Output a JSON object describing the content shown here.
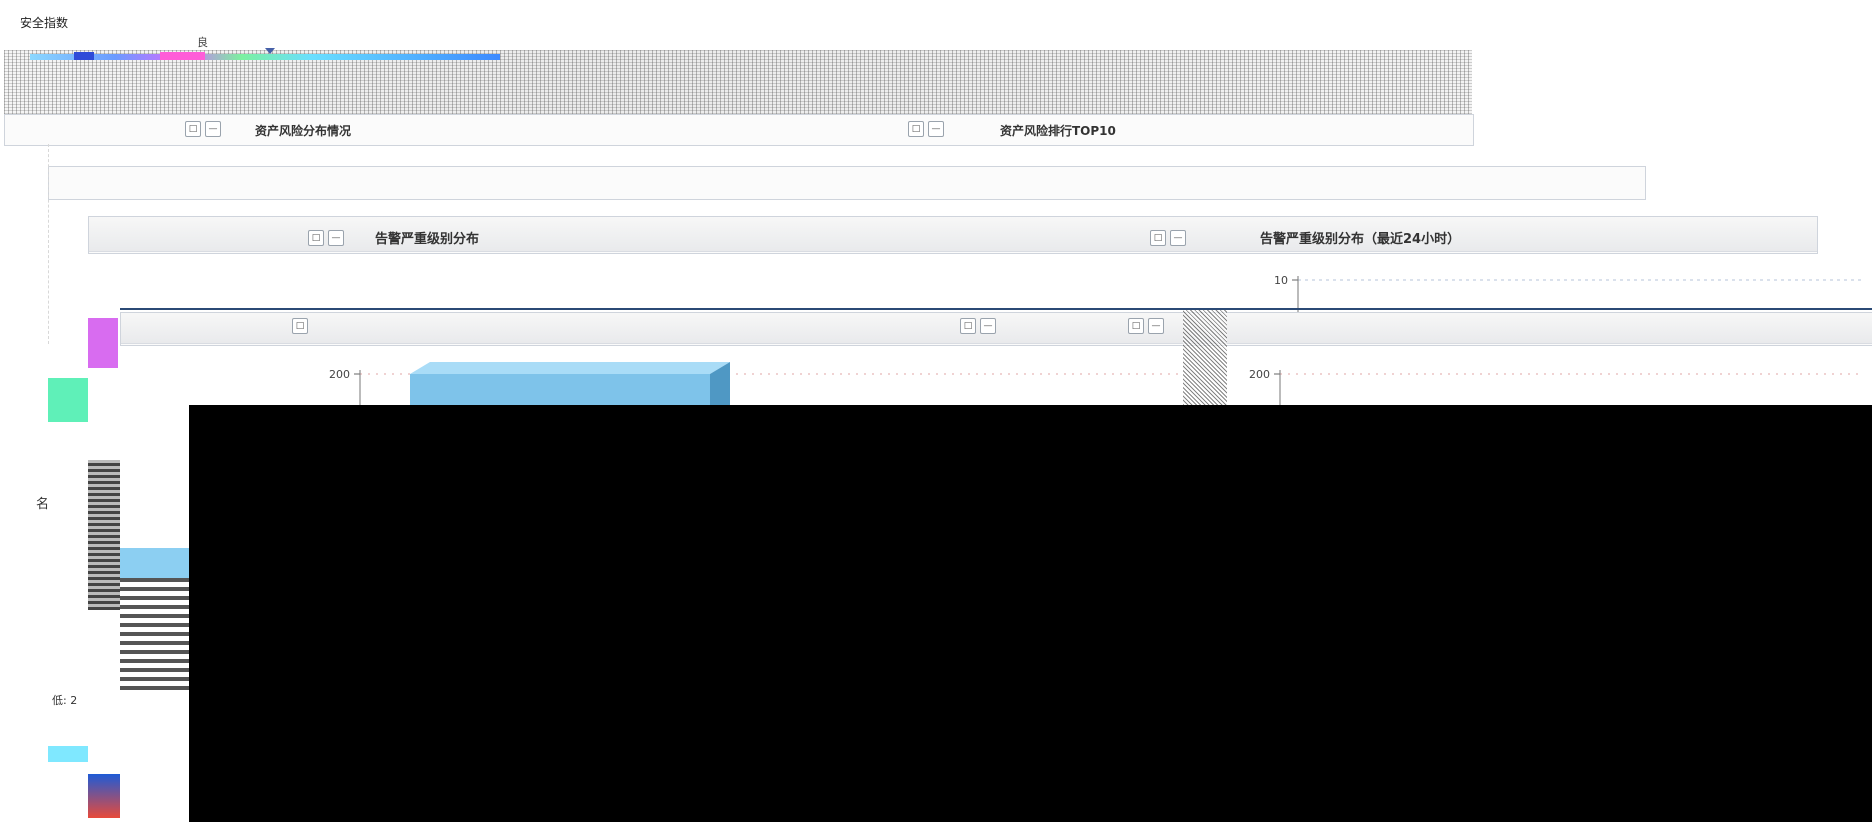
{
  "security_index": {
    "title": "安全指数",
    "rank_label": "良"
  },
  "panels": {
    "asset_risk_distribution": {
      "title": "资产风险分布情况"
    },
    "asset_risk_top10": {
      "title": "资产风险排行TOP10"
    },
    "alert_severity_distribution": {
      "title": "告警严重级别分布"
    },
    "alert_severity_24h": {
      "title": "告警严重级别分布（最近24小时）"
    }
  },
  "left_labels": {
    "low_count": "低: 2",
    "name_fragment": "名"
  },
  "window_buttons": {
    "restore": "□",
    "minimize": "—"
  },
  "chart_data": [
    {
      "type": "bar",
      "title": "",
      "xlabel": "",
      "ylabel": "",
      "ylim": [
        0,
        200
      ],
      "yticks": [
        200
      ],
      "categories": [
        ""
      ],
      "values": [
        200
      ],
      "grid": true
    },
    {
      "type": "bar",
      "title": "",
      "xlabel": "",
      "ylabel": "",
      "ylim": [
        0,
        200
      ],
      "yticks": [
        200
      ],
      "categories": [],
      "values": [],
      "grid": true
    },
    {
      "type": "line",
      "title": "",
      "xlabel": "",
      "ylabel": "",
      "ylim": [
        0,
        10
      ],
      "yticks": [
        10
      ],
      "series": [],
      "grid": true
    }
  ],
  "colors": {
    "panel_border": "#cfd4dc",
    "bar_blue": "#7ec3ea",
    "accent_purple": "#d86cf0",
    "accent_green": "#5ff0b8",
    "divider_navy": "#2b4a75"
  }
}
